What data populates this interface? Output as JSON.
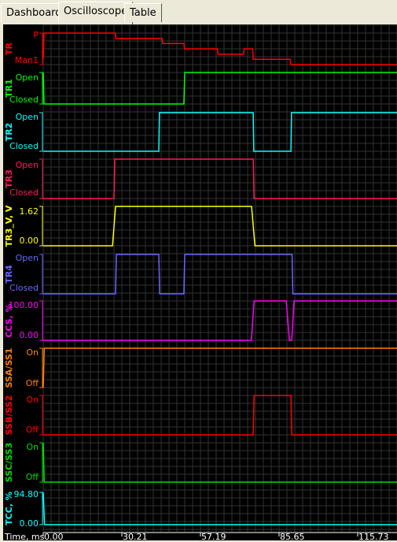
{
  "tabs": [
    {
      "label": "Dashboard",
      "active": false
    },
    {
      "label": "Oscilloscope",
      "active": true
    },
    {
      "label": "Table",
      "active": false
    }
  ],
  "time_axis": {
    "label": "Time, ms",
    "ticks": [
      "0.00",
      "30.21",
      "57.19",
      "85.65",
      "115.73"
    ]
  },
  "channels": [
    {
      "name": "TR",
      "color": "#ff0000",
      "high_label": "P",
      "low_label": "Man1",
      "points": [
        [
          0,
          5
        ],
        [
          0.3,
          0
        ],
        [
          27.7,
          0
        ],
        [
          27.9,
          1
        ],
        [
          44.0,
          1
        ],
        [
          44.2,
          2
        ],
        [
          51.5,
          2
        ],
        [
          51.7,
          3
        ],
        [
          63.3,
          3
        ],
        [
          63.5,
          4
        ],
        [
          72.8,
          4
        ],
        [
          73.0,
          3
        ],
        [
          76.1,
          3
        ],
        [
          76.3,
          5
        ],
        [
          89.9,
          5
        ],
        [
          90.1,
          6
        ],
        [
          131,
          6
        ]
      ]
    },
    {
      "name": "TR1",
      "color": "#00ff00",
      "high_label": "Open",
      "low_label": "Closed",
      "points": [
        [
          0,
          1
        ],
        [
          0.3,
          0
        ],
        [
          51.5,
          0
        ],
        [
          51.8,
          1
        ],
        [
          131,
          1
        ]
      ]
    },
    {
      "name": "TR2",
      "color": "#00ffff",
      "high_label": "Open",
      "low_label": "Closed",
      "points": [
        [
          0,
          0
        ],
        [
          42.9,
          0
        ],
        [
          43.1,
          1
        ],
        [
          76.3,
          1
        ],
        [
          76.5,
          0
        ],
        [
          90.2,
          0
        ],
        [
          90.4,
          1
        ],
        [
          131,
          1
        ]
      ]
    },
    {
      "name": "TR3",
      "color": "#ff1a5a",
      "high_label": "Open",
      "low_label": "Closed",
      "points": [
        [
          0,
          0
        ],
        [
          27.2,
          0
        ],
        [
          27.5,
          1
        ],
        [
          76.3,
          1
        ],
        [
          76.6,
          0
        ],
        [
          131,
          0
        ]
      ]
    },
    {
      "name": "TR3_V, V",
      "color": "#ffff00",
      "high_label": "1.62",
      "low_label": "0.00",
      "points": [
        [
          0,
          0
        ],
        [
          26.6,
          0
        ],
        [
          27.8,
          1.62
        ],
        [
          75.7,
          1.62
        ],
        [
          76.9,
          0
        ],
        [
          131,
          0
        ]
      ]
    },
    {
      "name": "TR4",
      "color": "#6666ff",
      "high_label": "Open",
      "low_label": "Closed",
      "points": [
        [
          0,
          0
        ],
        [
          27.8,
          0
        ],
        [
          28.1,
          1
        ],
        [
          42.9,
          1
        ],
        [
          43.2,
          0
        ],
        [
          51.5,
          0
        ],
        [
          51.8,
          1
        ],
        [
          90.6,
          1
        ],
        [
          90.9,
          0
        ],
        [
          131,
          0
        ]
      ]
    },
    {
      "name": "CCS, %",
      "color": "#ff00ff",
      "high_label": "100.00",
      "low_label": "0.00",
      "points": [
        [
          0,
          0
        ],
        [
          75.6,
          0
        ],
        [
          76.6,
          100
        ],
        [
          88.4,
          100
        ],
        [
          89.6,
          0
        ],
        [
          90.5,
          0
        ],
        [
          91.4,
          100
        ],
        [
          131,
          100
        ]
      ]
    },
    {
      "name": "SSA/SS1",
      "color": "#ff8000",
      "high_label": "On",
      "low_label": "Off",
      "points": [
        [
          0,
          0
        ],
        [
          0.4,
          1
        ],
        [
          131,
          1
        ]
      ]
    },
    {
      "name": "SSB/SS2",
      "color": "#ff0000",
      "high_label": "On",
      "low_label": "Off",
      "points": [
        [
          0,
          0
        ],
        [
          76.3,
          0
        ],
        [
          76.6,
          1
        ],
        [
          90.2,
          1
        ],
        [
          90.5,
          0
        ],
        [
          131,
          0
        ]
      ]
    },
    {
      "name": "SSC/SS3",
      "color": "#00dd00",
      "high_label": "On",
      "low_label": "Off",
      "points": [
        [
          0,
          1
        ],
        [
          0.4,
          0
        ],
        [
          131,
          0
        ]
      ]
    },
    {
      "name": "TCC, %",
      "color": "#00ffff",
      "high_label": "94.80",
      "low_label": "0.00",
      "points": [
        [
          0,
          94.8
        ],
        [
          0.5,
          0
        ],
        [
          131,
          0
        ]
      ]
    }
  ]
}
